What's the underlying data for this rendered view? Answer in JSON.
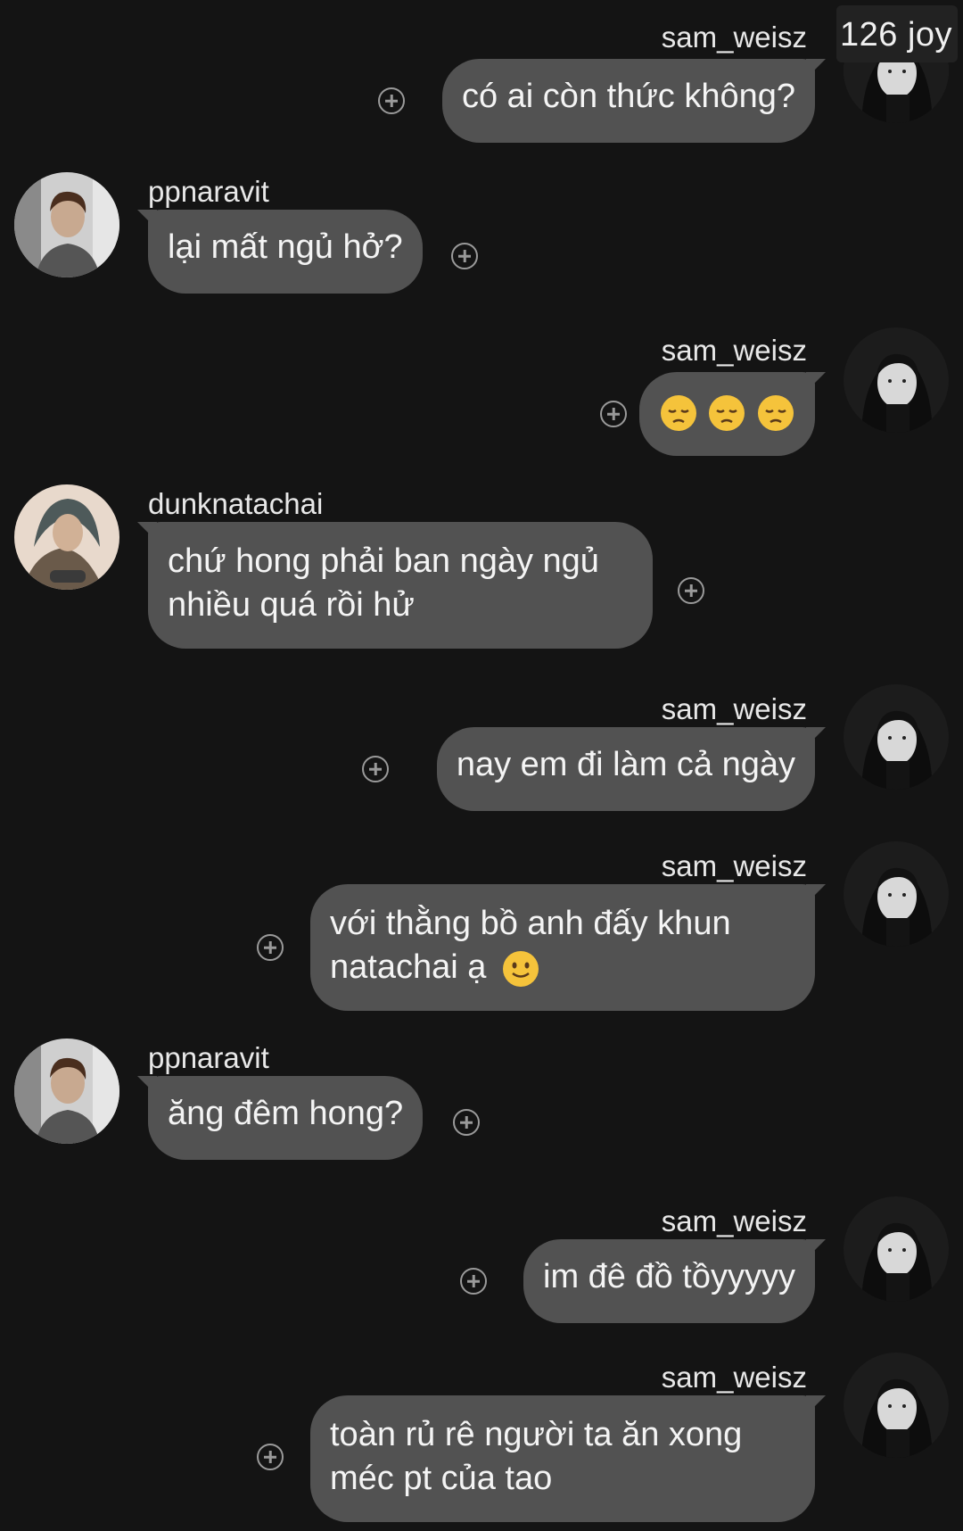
{
  "badge": {
    "count_label": "126 joy"
  },
  "messages": [
    {
      "side": "right",
      "author": "sam_weisz",
      "text": "có ai còn thức không?"
    },
    {
      "side": "left",
      "author": "ppnaravit",
      "text": "lại mất ngủ hở?"
    },
    {
      "side": "right",
      "author": "sam_weisz",
      "text": "",
      "emojis": [
        "pensive-face",
        "pensive-face",
        "pensive-face"
      ]
    },
    {
      "side": "left",
      "author": "dunknatachai",
      "text_line1": "chứ hong phải ban ngày ngủ",
      "text_line2": "nhiều quá rồi hử"
    },
    {
      "side": "right",
      "author": "sam_weisz",
      "text": "nay em đi làm cả ngày"
    },
    {
      "side": "right",
      "author": "sam_weisz",
      "text_line1": "với thằng bồ anh đấy khun",
      "text_line2": "natachai ạ",
      "emoji": "slightly-smiling-face"
    },
    {
      "side": "left",
      "author": "ppnaravit",
      "text": "ăng đêm hong?"
    },
    {
      "side": "right",
      "author": "sam_weisz",
      "text": "im đê đồ tồyyyyy"
    },
    {
      "side": "right",
      "author": "sam_weisz",
      "text_line1": "toàn rủ rê người ta ăn xong",
      "text_line2": "méc pt của tao"
    }
  ],
  "colors": {
    "background": "#141414",
    "bubble": "#525252",
    "text": "#f4f4f4",
    "username": "#e8e8e8",
    "add_icon": "#9a9a9a"
  }
}
